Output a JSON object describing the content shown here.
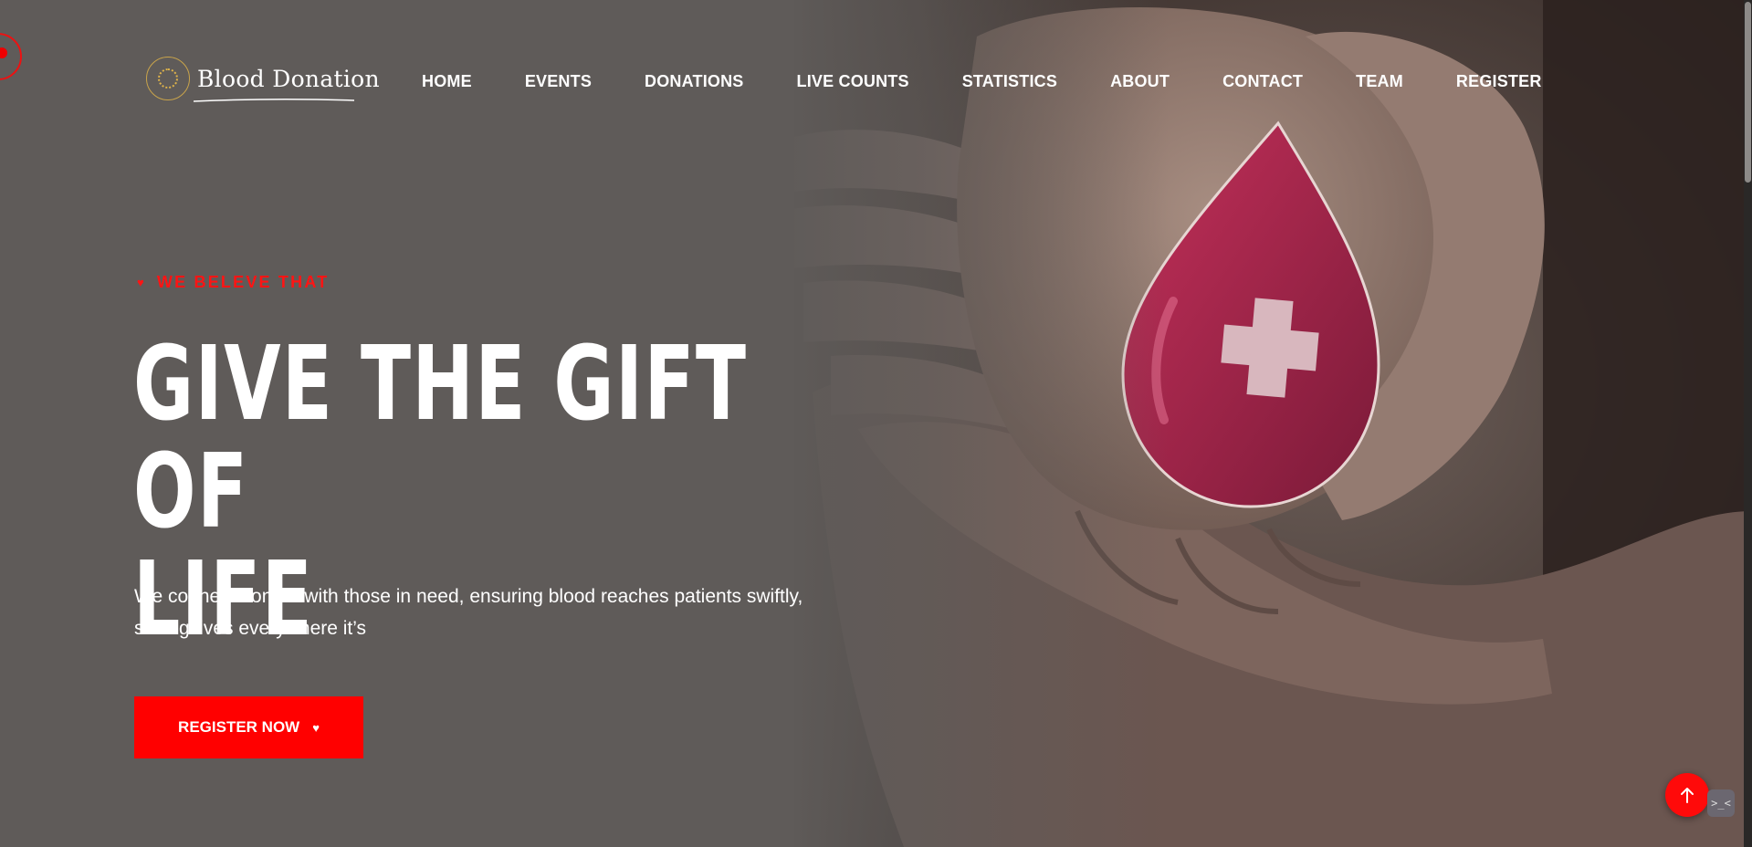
{
  "brand": {
    "name": "Blood Donation",
    "accent_color": "#ff0000",
    "logo_icon": "sun-emblem-icon"
  },
  "nav": {
    "items": [
      {
        "label": "HOME"
      },
      {
        "label": "EVENTS"
      },
      {
        "label": "DONATIONS"
      },
      {
        "label": "LIVE COUNTS"
      },
      {
        "label": "STATISTICS"
      },
      {
        "label": "ABOUT"
      },
      {
        "label": "CONTACT"
      },
      {
        "label": "TEAM"
      },
      {
        "label": "REGISTER"
      }
    ]
  },
  "hero": {
    "tagline": "WE BELEVE THAT",
    "tagline_icon": "heart-icon",
    "headline_line1": "GIVE THE GIFT OF",
    "headline_line2": "LIFE",
    "description": "We connect donors with those in need, ensuring blood reaches patients swiftly, saving lives everywhere it’s",
    "cta_label": "REGISTER NOW",
    "cta_icon": "heart-icon",
    "image": "hands-holding-blood-drop-photo"
  },
  "floating": {
    "scroll_top_icon": "arrow-up-icon",
    "chat_icon": "terminal-chat-icon"
  }
}
